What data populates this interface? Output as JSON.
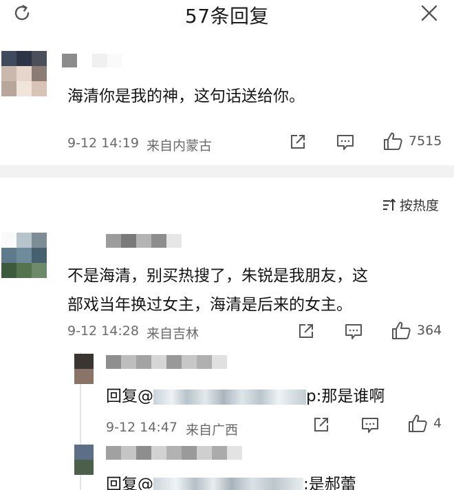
{
  "header": {
    "title": "57条回复",
    "refresh_icon": "refresh-icon",
    "close_icon": "close-icon"
  },
  "main_comment": {
    "text": "海清你是我的神，这句话送给你。",
    "time": "9-12 14:19",
    "location": "来自内蒙古",
    "likes": "7515"
  },
  "sort": {
    "label": "按热度",
    "icon": "sort-icon"
  },
  "replies": [
    {
      "line1": "不是海清，别买热搜了，朱锐是我朋友，这",
      "line2": "部戏当年换过女主，海清是后来的女主。",
      "time": "9-12 14:28",
      "location": "来自吉林",
      "likes": "364"
    }
  ],
  "sub_replies": [
    {
      "prefix": "回复@",
      "suffix": "p:那是谁啊",
      "time": "9-12 14:47",
      "location": "来自广西",
      "likes": "4"
    },
    {
      "prefix": "回复@",
      "suffix": ":是郝蕾"
    }
  ],
  "colors": {
    "divider": "#f2f2f2",
    "meta_text": "#6a6a6a",
    "icon_stroke": "#555555"
  }
}
